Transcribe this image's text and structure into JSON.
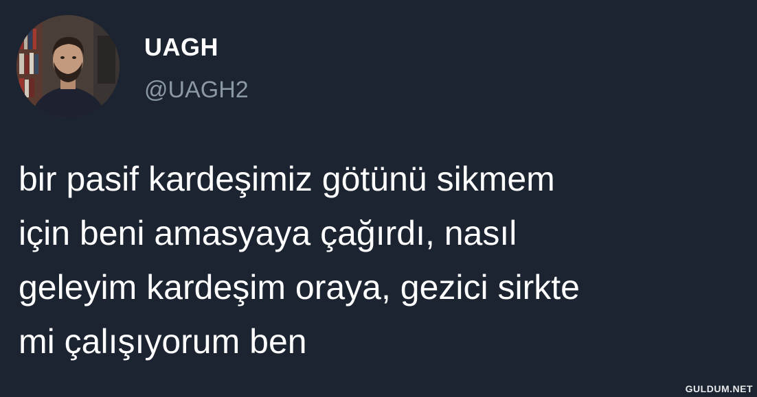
{
  "user": {
    "display_name": "UAGH",
    "handle": "@UAGH2",
    "avatar_icon": "profile-photo-icon"
  },
  "tweet": {
    "lines": [
      "bir pasif kardeşimiz götünü sikmem",
      "için beni amasyaya çağırdı, nasıl",
      "geleyim kardeşim oraya, gezici sirkte",
      "mi çalışıyorum ben"
    ]
  },
  "watermark": "GULDUM.NET",
  "colors": {
    "background": "#1c2431",
    "text": "#ffffff",
    "handle": "#8b98a5"
  }
}
